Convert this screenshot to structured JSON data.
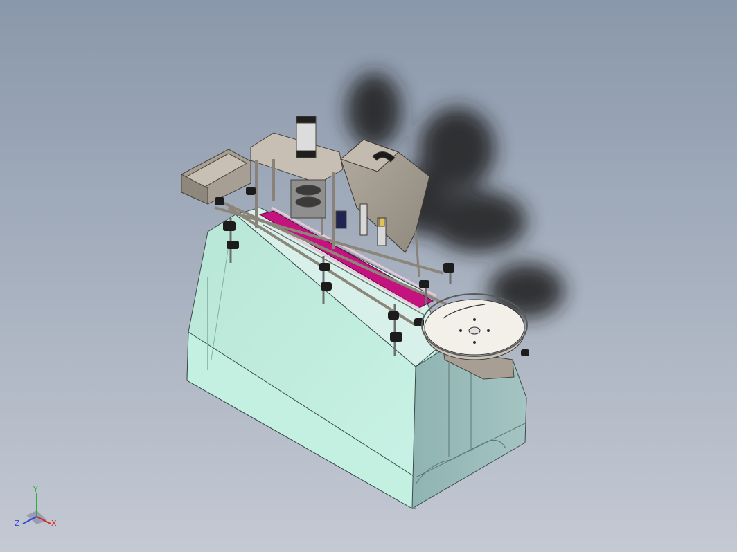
{
  "viewport": {
    "background_top": "#8a98ab",
    "background_bottom": "#c4c9d3"
  },
  "colors": {
    "cabinet_front": "#c6f0e2",
    "cabinet_side": "#93b7b7",
    "cabinet_top": "#d5efe8",
    "conveyor_belt": "#c4127e",
    "steel_frame": "#bdb4a8",
    "hopper": "#a79f93",
    "turntable": "#f2efe8",
    "shadow": "#1c1c1c"
  },
  "triad": {
    "x_label": "X",
    "y_label": "Y",
    "z_label": "Z",
    "x_color": "#d62a2a",
    "y_color": "#2fae3a",
    "z_color": "#2a46d6"
  }
}
